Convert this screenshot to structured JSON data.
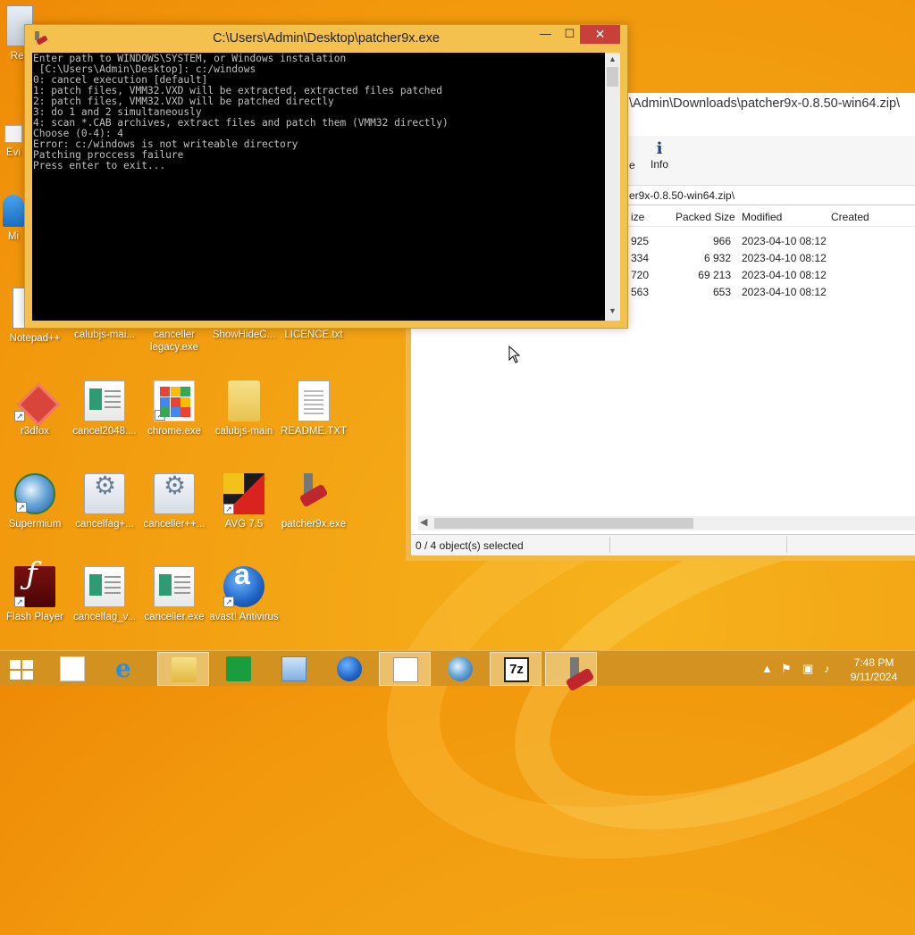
{
  "console_window": {
    "title": "C:\\Users\\Admin\\Desktop\\patcher9x.exe",
    "output": "Enter path to WINDOWS\\SYSTEM, or Windows instalation\n [C:\\Users\\Admin\\Desktop]: c:/windows\n0: cancel execution [default]\n1: patch files, VMM32.VXD will be extracted, extracted files patched\n2: patch files, VMM32.VXD will be patched directly\n3: do 1 and 2 simultaneously\n4: scan *.CAB archives, extract files and patch them (VMM32 directly)\nChoose (0-4): 4\nError: c:/windows is not writeable directory\nPatching proccess failure\nPress enter to exit...",
    "minimize_glyph": "—",
    "maximize_glyph": "☐",
    "close_glyph": "✕"
  },
  "zip_window": {
    "title": "\\Admin\\Downloads\\patcher9x-0.8.50-win64.zip\\",
    "toolbar": [
      {
        "label": "e"
      },
      {
        "label": "Info"
      }
    ],
    "path": "er9x-0.8.50-win64.zip\\",
    "columns": [
      "ize",
      "Packed Size",
      "Modified",
      "Created"
    ],
    "rows": [
      {
        "size": "925",
        "packed": "966",
        "modified": "2023-04-10 08:12"
      },
      {
        "size": "334",
        "packed": "6 932",
        "modified": "2023-04-10 08:12"
      },
      {
        "size": "720",
        "packed": "69 213",
        "modified": "2023-04-10 08:12"
      },
      {
        "size": "563",
        "packed": "653",
        "modified": "2023-04-10 08:12"
      }
    ],
    "status": "0 / 4 object(s) selected"
  },
  "desktop_icons": [
    {
      "label": "Rec",
      "icon": "recycle-bin-icon"
    },
    {
      "label": "Evi",
      "icon": "app-icon"
    },
    {
      "label": "Mi",
      "icon": "app-icon"
    },
    {
      "label": "Notepad++",
      "icon": "notepad-icon"
    },
    {
      "label": "calubjs-mai...",
      "icon": "app-icon"
    },
    {
      "label": "canceller legacy.exe",
      "icon": "app-icon"
    },
    {
      "label": "ShowHideC...",
      "icon": "app-icon"
    },
    {
      "label": "LICENCE.txt",
      "icon": "text-file-icon"
    },
    {
      "label": "r3dfox",
      "icon": "r3dfox-icon"
    },
    {
      "label": "cancel2048....",
      "icon": "app-icon"
    },
    {
      "label": "chrome.exe",
      "icon": "chrome-icon"
    },
    {
      "label": "calubjs-main",
      "icon": "folder-icon"
    },
    {
      "label": "README.TXT",
      "icon": "text-file-icon"
    },
    {
      "label": "Supermium",
      "icon": "supermium-icon"
    },
    {
      "label": "cancelfag+...",
      "icon": "gear-app-icon"
    },
    {
      "label": "canceller++...",
      "icon": "gear-app-icon"
    },
    {
      "label": "AVG 7.5",
      "icon": "avg-icon"
    },
    {
      "label": "patcher9x.exe",
      "icon": "patcher-icon"
    },
    {
      "label": "Flash Player",
      "icon": "flash-icon"
    },
    {
      "label": "cancelfag_v...",
      "icon": "app-icon"
    },
    {
      "label": "canceller.exe",
      "icon": "app-icon"
    },
    {
      "label": "avast! Antivirus",
      "icon": "avast-icon"
    }
  ],
  "taskbar": {
    "pinned": [
      "start-icon",
      "apps-icon",
      "internet-explorer-icon",
      "file-explorer-icon",
      "store-icon",
      "control-panel-icon",
      "avast-icon",
      "task-manager-icon",
      "supermium-icon",
      "7zip-icon",
      "patcher-icon"
    ],
    "sevenzip_label": "7z",
    "time": "7:48 PM",
    "date": "9/11/2024"
  }
}
